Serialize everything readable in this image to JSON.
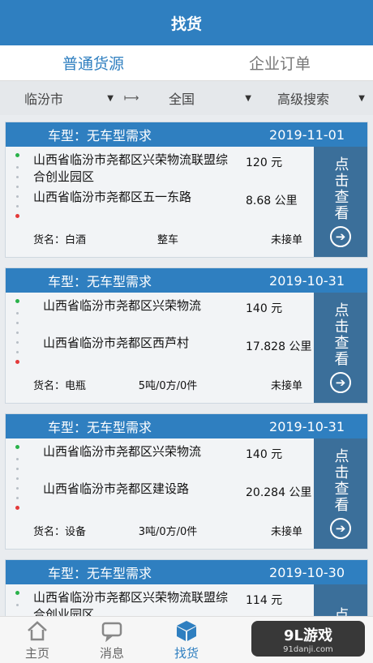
{
  "header": {
    "title": "找货"
  },
  "tabs": [
    {
      "label": "普通货源",
      "active": true
    },
    {
      "label": "企业订单",
      "active": false
    }
  ],
  "filters": {
    "origin": "临汾市",
    "destination": "全国",
    "advanced": "高级搜索"
  },
  "cards": [
    {
      "vehicle": "车型：无车型需求",
      "date": "2019-11-01",
      "from": "山西省临汾市尧都区兴荣物流联盟综合创业园区",
      "price": "120 元",
      "to": "山西省临汾市尧都区五一东路",
      "distance": "8.68 公里",
      "goods": "货名：白酒",
      "spec": "整车",
      "status": "未接单",
      "button": "点击查看"
    },
    {
      "vehicle": "车型：无车型需求",
      "date": "2019-10-31",
      "from": "山西省临汾市尧都区兴荣物流",
      "price": "140 元",
      "to": "山西省临汾市尧都区西芦村",
      "distance": "17.828 公里",
      "goods": "货名：电瓶",
      "spec": "5吨/0方/0件",
      "status": "未接单",
      "button": "点击查看"
    },
    {
      "vehicle": "车型：无车型需求",
      "date": "2019-10-31",
      "from": "山西省临汾市尧都区兴荣物流",
      "price": "140 元",
      "to": "山西省临汾市尧都区建设路",
      "distance": "20.284 公里",
      "goods": "货名：设备",
      "spec": "3吨/0方/0件",
      "status": "未接单",
      "button": "点击查看"
    },
    {
      "vehicle": "车型：无车型需求",
      "date": "2019-10-30",
      "from": "山西省临汾市尧都区兴荣物流联盟综合创业园区",
      "price": "114 元",
      "to": "",
      "distance": "",
      "goods": "",
      "spec": "",
      "status": "",
      "button": "点击查看"
    }
  ],
  "tabbar": [
    {
      "label": "主页",
      "icon": "home-icon",
      "active": false
    },
    {
      "label": "消息",
      "icon": "message-icon",
      "active": false
    },
    {
      "label": "找货",
      "icon": "cargo-box-icon",
      "active": true
    }
  ],
  "watermark": {
    "brand": "9L游戏",
    "url": "91danji.com"
  }
}
